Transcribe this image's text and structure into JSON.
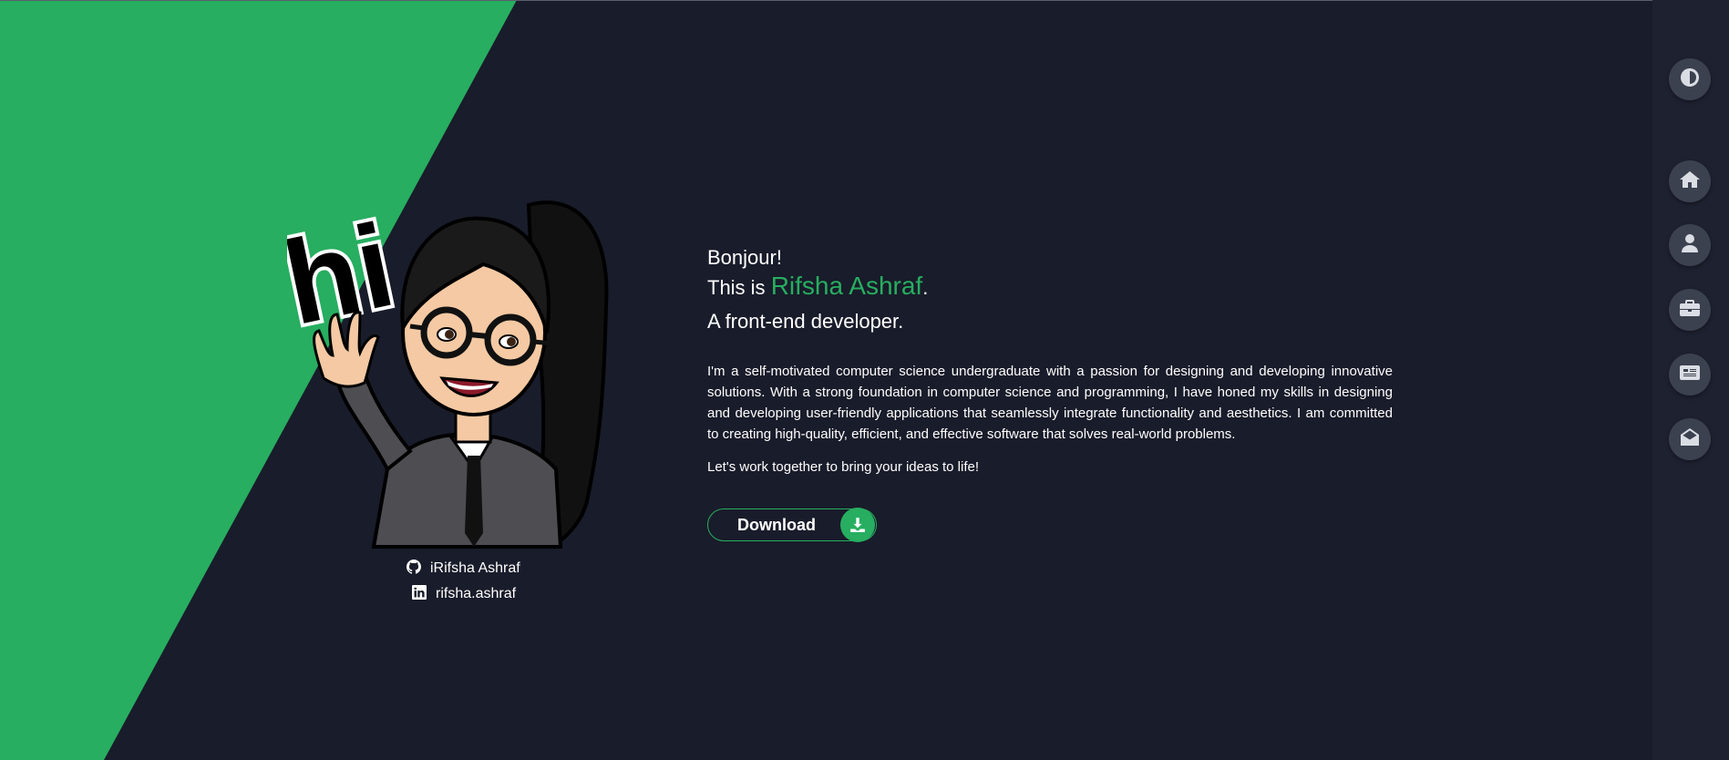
{
  "hero": {
    "greeting": "Bonjour!",
    "intro_prefix": "This is ",
    "name": "Rifsha Ashraf",
    "intro_suffix": ".",
    "role": "A front-end developer.",
    "bio": "I'm a self-motivated computer science undergraduate with a passion for designing and developing innovative solutions. With a strong foundation in computer science and programming, I have honed my skills in designing and developing user-friendly applications that seamlessly integrate functionality and aesthetics. I am committed to creating high-quality, efficient, and effective software that solves real-world problems.",
    "cta": "Let's work together to bring your ideas to life!",
    "download_label": "Download",
    "download_icon": "download-icon"
  },
  "avatar": {
    "sticker_text": "hi"
  },
  "socials": [
    {
      "icon": "github-icon",
      "label": "iRifsha Ashraf"
    },
    {
      "icon": "linkedin-icon",
      "label": "rifsha.ashraf"
    }
  ],
  "sidebar": {
    "theme_toggle_icon": "contrast-icon",
    "items": [
      {
        "icon": "home-icon"
      },
      {
        "icon": "user-icon"
      },
      {
        "icon": "briefcase-icon"
      },
      {
        "icon": "newspaper-icon"
      },
      {
        "icon": "envelope-open-icon"
      }
    ]
  },
  "colors": {
    "accent": "#27ae60",
    "background": "#191c2a",
    "sidebar": "#1e2130",
    "nav_button": "#3c4150"
  }
}
